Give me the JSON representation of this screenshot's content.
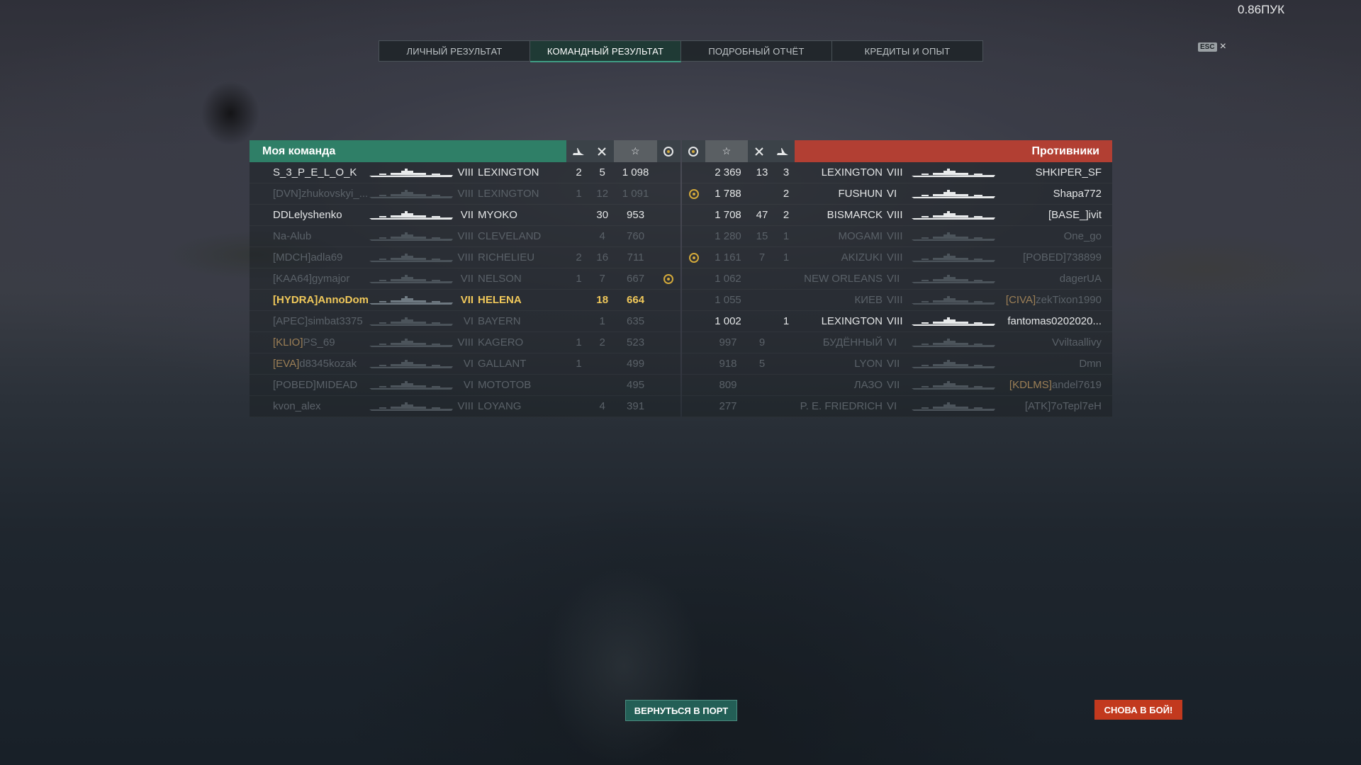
{
  "version": "0.86ПУК",
  "esc": {
    "key": "ESC",
    "close": "×"
  },
  "tabs": [
    "ЛИЧНЫЙ РЕЗУЛЬТАТ",
    "КОМАНДНЫЙ РЕЗУЛЬТАТ",
    "ПОДРОБНЫЙ ОТЧЁТ",
    "КРЕДИТЫ И ОПЫТ"
  ],
  "active_tab": 1,
  "colors": {
    "my_team": "#2f7f67",
    "enemy_team": "#b23f33",
    "player_highlight": "#f0c85a",
    "accent_button": "#c2391e",
    "achievement": "#d3a93a"
  },
  "my_team": {
    "title": "Моя команда",
    "rows": [
      {
        "clan": "",
        "name": "S_3_P_E_L_O_K",
        "tier": "VIII",
        "ship": "LEXINGTON",
        "planes": "2",
        "frags": "5",
        "xp": "1 098",
        "ach": false,
        "status": "alive"
      },
      {
        "clan": "[DVN]",
        "name": "zhukovskyi_...",
        "tier": "VIII",
        "ship": "LEXINGTON",
        "planes": "1",
        "frags": "12",
        "xp": "1 091",
        "ach": false,
        "status": "dead"
      },
      {
        "clan": "",
        "name": "DDLelyshenko",
        "tier": "VII",
        "ship": "MYOKO",
        "planes": "",
        "frags": "30",
        "xp": "953",
        "ach": false,
        "status": "alive"
      },
      {
        "clan": "",
        "name": "Na-Alub",
        "tier": "VIII",
        "ship": "CLEVELAND",
        "planes": "",
        "frags": "4",
        "xp": "760",
        "ach": false,
        "status": "dead"
      },
      {
        "clan": "[MDCH]",
        "name": "adla69",
        "tier": "VIII",
        "ship": "RICHELIEU",
        "planes": "2",
        "frags": "16",
        "xp": "711",
        "ach": false,
        "status": "dead"
      },
      {
        "clan": "[KAA64]",
        "name": "gymajor",
        "tier": "VII",
        "ship": "NELSON",
        "planes": "1",
        "frags": "7",
        "xp": "667",
        "ach": true,
        "status": "dead"
      },
      {
        "clan": "[HYDRA]",
        "name": "AnnoDomi...",
        "tier": "VII",
        "ship": "HELENA",
        "planes": "",
        "frags": "18",
        "xp": "664",
        "ach": false,
        "status": "me"
      },
      {
        "clan": "[APEC]",
        "name": "simbat3375",
        "tier": "VI",
        "ship": "BAYERN",
        "planes": "",
        "frags": "1",
        "xp": "635",
        "ach": false,
        "status": "dead"
      },
      {
        "clan": "[KLIO]",
        "name": "PS_69",
        "tier": "VIII",
        "ship": "KAGERO",
        "planes": "1",
        "frags": "2",
        "xp": "523",
        "ach": false,
        "status": "dead",
        "clan_gold": true
      },
      {
        "clan": "[EVA]",
        "name": "d8345kozak",
        "tier": "VI",
        "ship": "GALLANT",
        "planes": "1",
        "frags": "",
        "xp": "499",
        "ach": false,
        "status": "dead",
        "clan_gold": true
      },
      {
        "clan": "[POBED]",
        "name": "MIDEAD",
        "tier": "VI",
        "ship": "MOTOTOB",
        "planes": "",
        "frags": "",
        "xp": "495",
        "ach": false,
        "status": "dead"
      },
      {
        "clan": "",
        "name": "kvon_alex",
        "tier": "VIII",
        "ship": "LOYANG",
        "planes": "",
        "frags": "4",
        "xp": "391",
        "ach": false,
        "status": "dead"
      }
    ]
  },
  "enemy_team": {
    "title": "Противники",
    "rows": [
      {
        "clan": "",
        "name": "SHKIPER_SF",
        "tier": "VIII",
        "ship": "LEXINGTON",
        "planes": "3",
        "frags": "13",
        "xp": "2 369",
        "ach": false,
        "status": "alive"
      },
      {
        "clan": "",
        "name": "Shapa772",
        "tier": "VI",
        "ship": "FUSHUN",
        "planes": "2",
        "frags": "",
        "xp": "1 788",
        "ach": true,
        "status": "alive"
      },
      {
        "clan": "[BASE_]",
        "name": "ivit",
        "tier": "VIII",
        "ship": "BISMARCK",
        "planes": "2",
        "frags": "47",
        "xp": "1 708",
        "ach": false,
        "status": "alive"
      },
      {
        "clan": "",
        "name": "One_go",
        "tier": "VIII",
        "ship": "MOGAMI",
        "planes": "1",
        "frags": "15",
        "xp": "1 280",
        "ach": false,
        "status": "dead"
      },
      {
        "clan": "[POBED]",
        "name": "738899",
        "tier": "VIII",
        "ship": "AKIZUKI",
        "planes": "1",
        "frags": "7",
        "xp": "1 161",
        "ach": true,
        "status": "dead"
      },
      {
        "clan": "",
        "name": "dagerUA",
        "tier": "VII",
        "ship": "NEW ORLEANS",
        "planes": "",
        "frags": "",
        "xp": "1 062",
        "ach": false,
        "status": "dead"
      },
      {
        "clan": "[CIVA]",
        "name": "zekTixon1990",
        "tier": "VIII",
        "ship": "КИЕВ",
        "planes": "",
        "frags": "",
        "xp": "1 055",
        "ach": false,
        "status": "dead",
        "clan_gold": true
      },
      {
        "clan": "",
        "name": "fantomas0202020...",
        "tier": "VIII",
        "ship": "LEXINGTON",
        "planes": "1",
        "frags": "",
        "xp": "1 002",
        "ach": false,
        "status": "alive"
      },
      {
        "clan": "",
        "name": "Vviltaallivy",
        "tier": "VI",
        "ship": "БУДЁННЫЙ",
        "planes": "",
        "frags": "9",
        "xp": "997",
        "ach": false,
        "status": "dead"
      },
      {
        "clan": "",
        "name": "Dmn",
        "tier": "VII",
        "ship": "LYON",
        "planes": "",
        "frags": "5",
        "xp": "918",
        "ach": false,
        "status": "dead"
      },
      {
        "clan": "[KDLMS]",
        "name": "andel7619",
        "tier": "VII",
        "ship": "ЛАЗО",
        "planes": "",
        "frags": "",
        "xp": "809",
        "ach": false,
        "status": "dead",
        "clan_gold": true
      },
      {
        "clan": "[ATK]",
        "name": "7oTepl7eH",
        "tier": "VI",
        "ship": "P. E. FRIEDRICH",
        "planes": "",
        "frags": "",
        "xp": "277",
        "ach": false,
        "status": "dead"
      }
    ]
  },
  "buttons": {
    "return_port": "ВЕРНУТЬСЯ В ПОРТ",
    "battle_again": "СНОВА В БОЙ!"
  }
}
